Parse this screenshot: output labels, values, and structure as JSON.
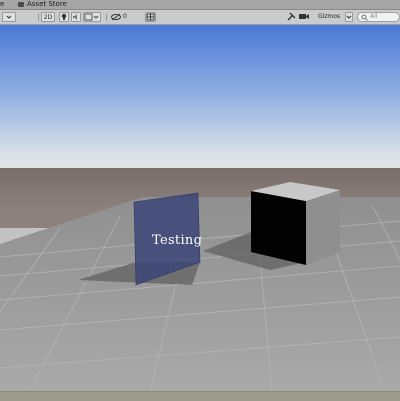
{
  "tabs": {
    "game_partial": "e",
    "asset_store": "Asset Store"
  },
  "toolbar": {
    "mode_2d": "2D",
    "hidden_layers_count": "0",
    "gizmos": "Gizmos",
    "search_placeholder": "All"
  },
  "scene": {
    "label": "Testing"
  },
  "colors": {
    "sky_top": "#4d7bd8",
    "horizon": "#e2e4e3",
    "ground_far": "#7a6e6a",
    "plane": "#9e9e9e",
    "panel": "#3a4675",
    "ui_bar": "#cbcbcb"
  },
  "icons": {
    "lighting": "lightbulb-icon",
    "audio": "speaker-icon",
    "effects": "image-layers-icon",
    "hidden_layers": "eye-slash-icon",
    "grid": "grid-icon",
    "tools": "tools-icon",
    "camera": "camera-icon",
    "search": "search-icon"
  }
}
